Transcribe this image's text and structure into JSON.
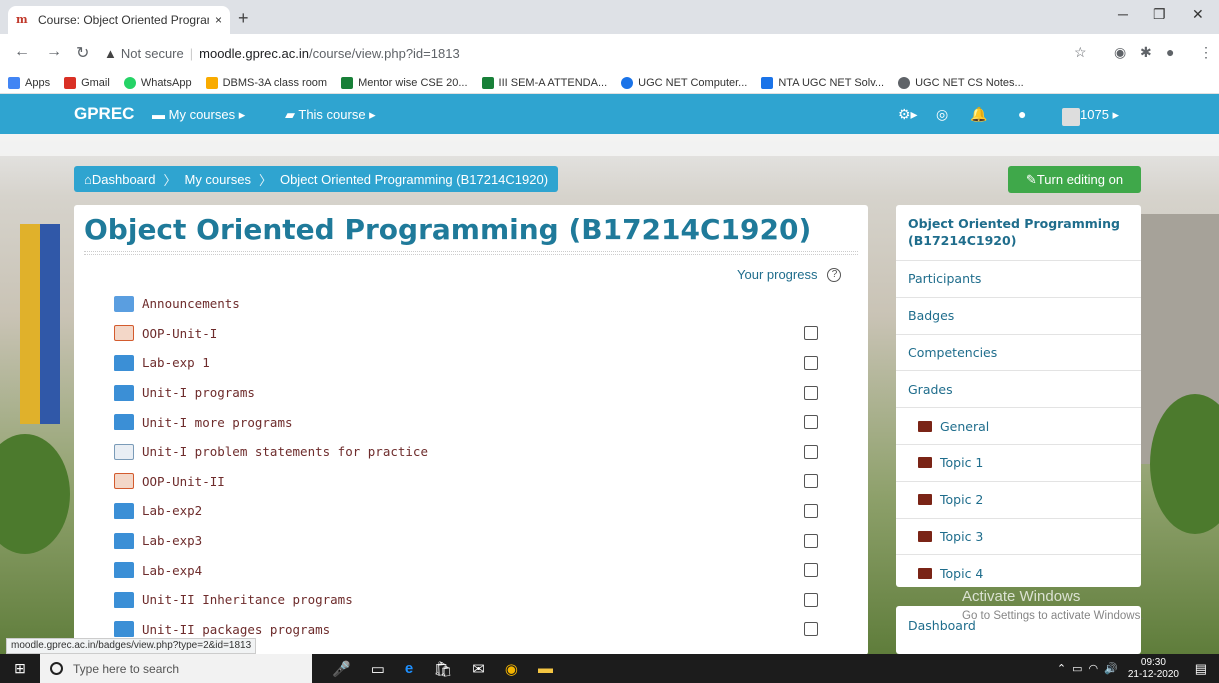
{
  "browser": {
    "tab_title": "Course: Object Oriented Program",
    "tab_close": "×",
    "new_tab": "+",
    "url_warning": "Not secure",
    "url_host": "moodle.gprec.ac.in",
    "url_path": "/course/view.php?id=1813",
    "bookmarks": [
      {
        "label": "Apps",
        "color": "#4285f4"
      },
      {
        "label": "Gmail",
        "color": "#d93025"
      },
      {
        "label": "WhatsApp",
        "color": "#25d366"
      },
      {
        "label": "DBMS-3A class room",
        "color": "#f9ab00"
      },
      {
        "label": "Mentor wise CSE 20...",
        "color": "#188038"
      },
      {
        "label": "III SEM-A ATTENDA...",
        "color": "#188038"
      },
      {
        "label": "UGC NET Computer...",
        "color": "#1a73e8"
      },
      {
        "label": "NTA UGC NET Solv...",
        "color": "#1a73e8"
      },
      {
        "label": "UGC NET CS Notes...",
        "color": "#5f6368"
      }
    ]
  },
  "navbar": {
    "brand": "GPREC",
    "my_courses": "My courses ▸",
    "this_course": "This course ▸",
    "user_label": "1075 ▸"
  },
  "breadcrumb": {
    "items": [
      "Dashboard",
      "My courses",
      "Object Oriented Programming (B17214C1920)"
    ]
  },
  "edit_button": "Turn editing on",
  "course": {
    "title": "Object Oriented Programming (B17214C1920)",
    "progress_label": "Your progress",
    "activities": [
      {
        "label": "Announcements",
        "icon": "forum",
        "has_check": false
      },
      {
        "label": "OOP-Unit-I",
        "icon": "ppt",
        "has_check": true
      },
      {
        "label": "Lab-exp 1",
        "icon": "folder",
        "has_check": true
      },
      {
        "label": "Unit-I programs",
        "icon": "folder",
        "has_check": true
      },
      {
        "label": "Unit-I more programs",
        "icon": "folder",
        "has_check": true
      },
      {
        "label": "Unit-I problem statements for practice",
        "icon": "page",
        "has_check": true
      },
      {
        "label": "OOP-Unit-II",
        "icon": "ppt",
        "has_check": true
      },
      {
        "label": "Lab-exp2",
        "icon": "folder",
        "has_check": true
      },
      {
        "label": "Lab-exp3",
        "icon": "folder",
        "has_check": true
      },
      {
        "label": "Lab-exp4",
        "icon": "folder",
        "has_check": true
      },
      {
        "label": "Unit-II Inheritance programs",
        "icon": "folder",
        "has_check": true
      },
      {
        "label": "Unit-II packages programs",
        "icon": "folder",
        "has_check": true
      }
    ]
  },
  "sidebar": {
    "title": "Object Oriented Programming (B17214C1920)",
    "items": [
      {
        "label": "Participants",
        "sub": false
      },
      {
        "label": "Badges",
        "sub": false
      },
      {
        "label": "Competencies",
        "sub": false
      },
      {
        "label": "Grades",
        "sub": false
      },
      {
        "label": "General",
        "sub": true
      },
      {
        "label": "Topic 1",
        "sub": true
      },
      {
        "label": "Topic 2",
        "sub": true
      },
      {
        "label": "Topic 3",
        "sub": true
      },
      {
        "label": "Topic 4",
        "sub": true
      }
    ],
    "dashboard_label": "Dashboard"
  },
  "watermark": {
    "line1": "Activate Windows",
    "line2": "Go to Settings to activate Windows."
  },
  "status_url": "moodle.gprec.ac.in/badges/view.php?type=2&id=1813",
  "taskbar": {
    "search_placeholder": "Type here to search",
    "time": "09:30",
    "date": "21-12-2020"
  }
}
